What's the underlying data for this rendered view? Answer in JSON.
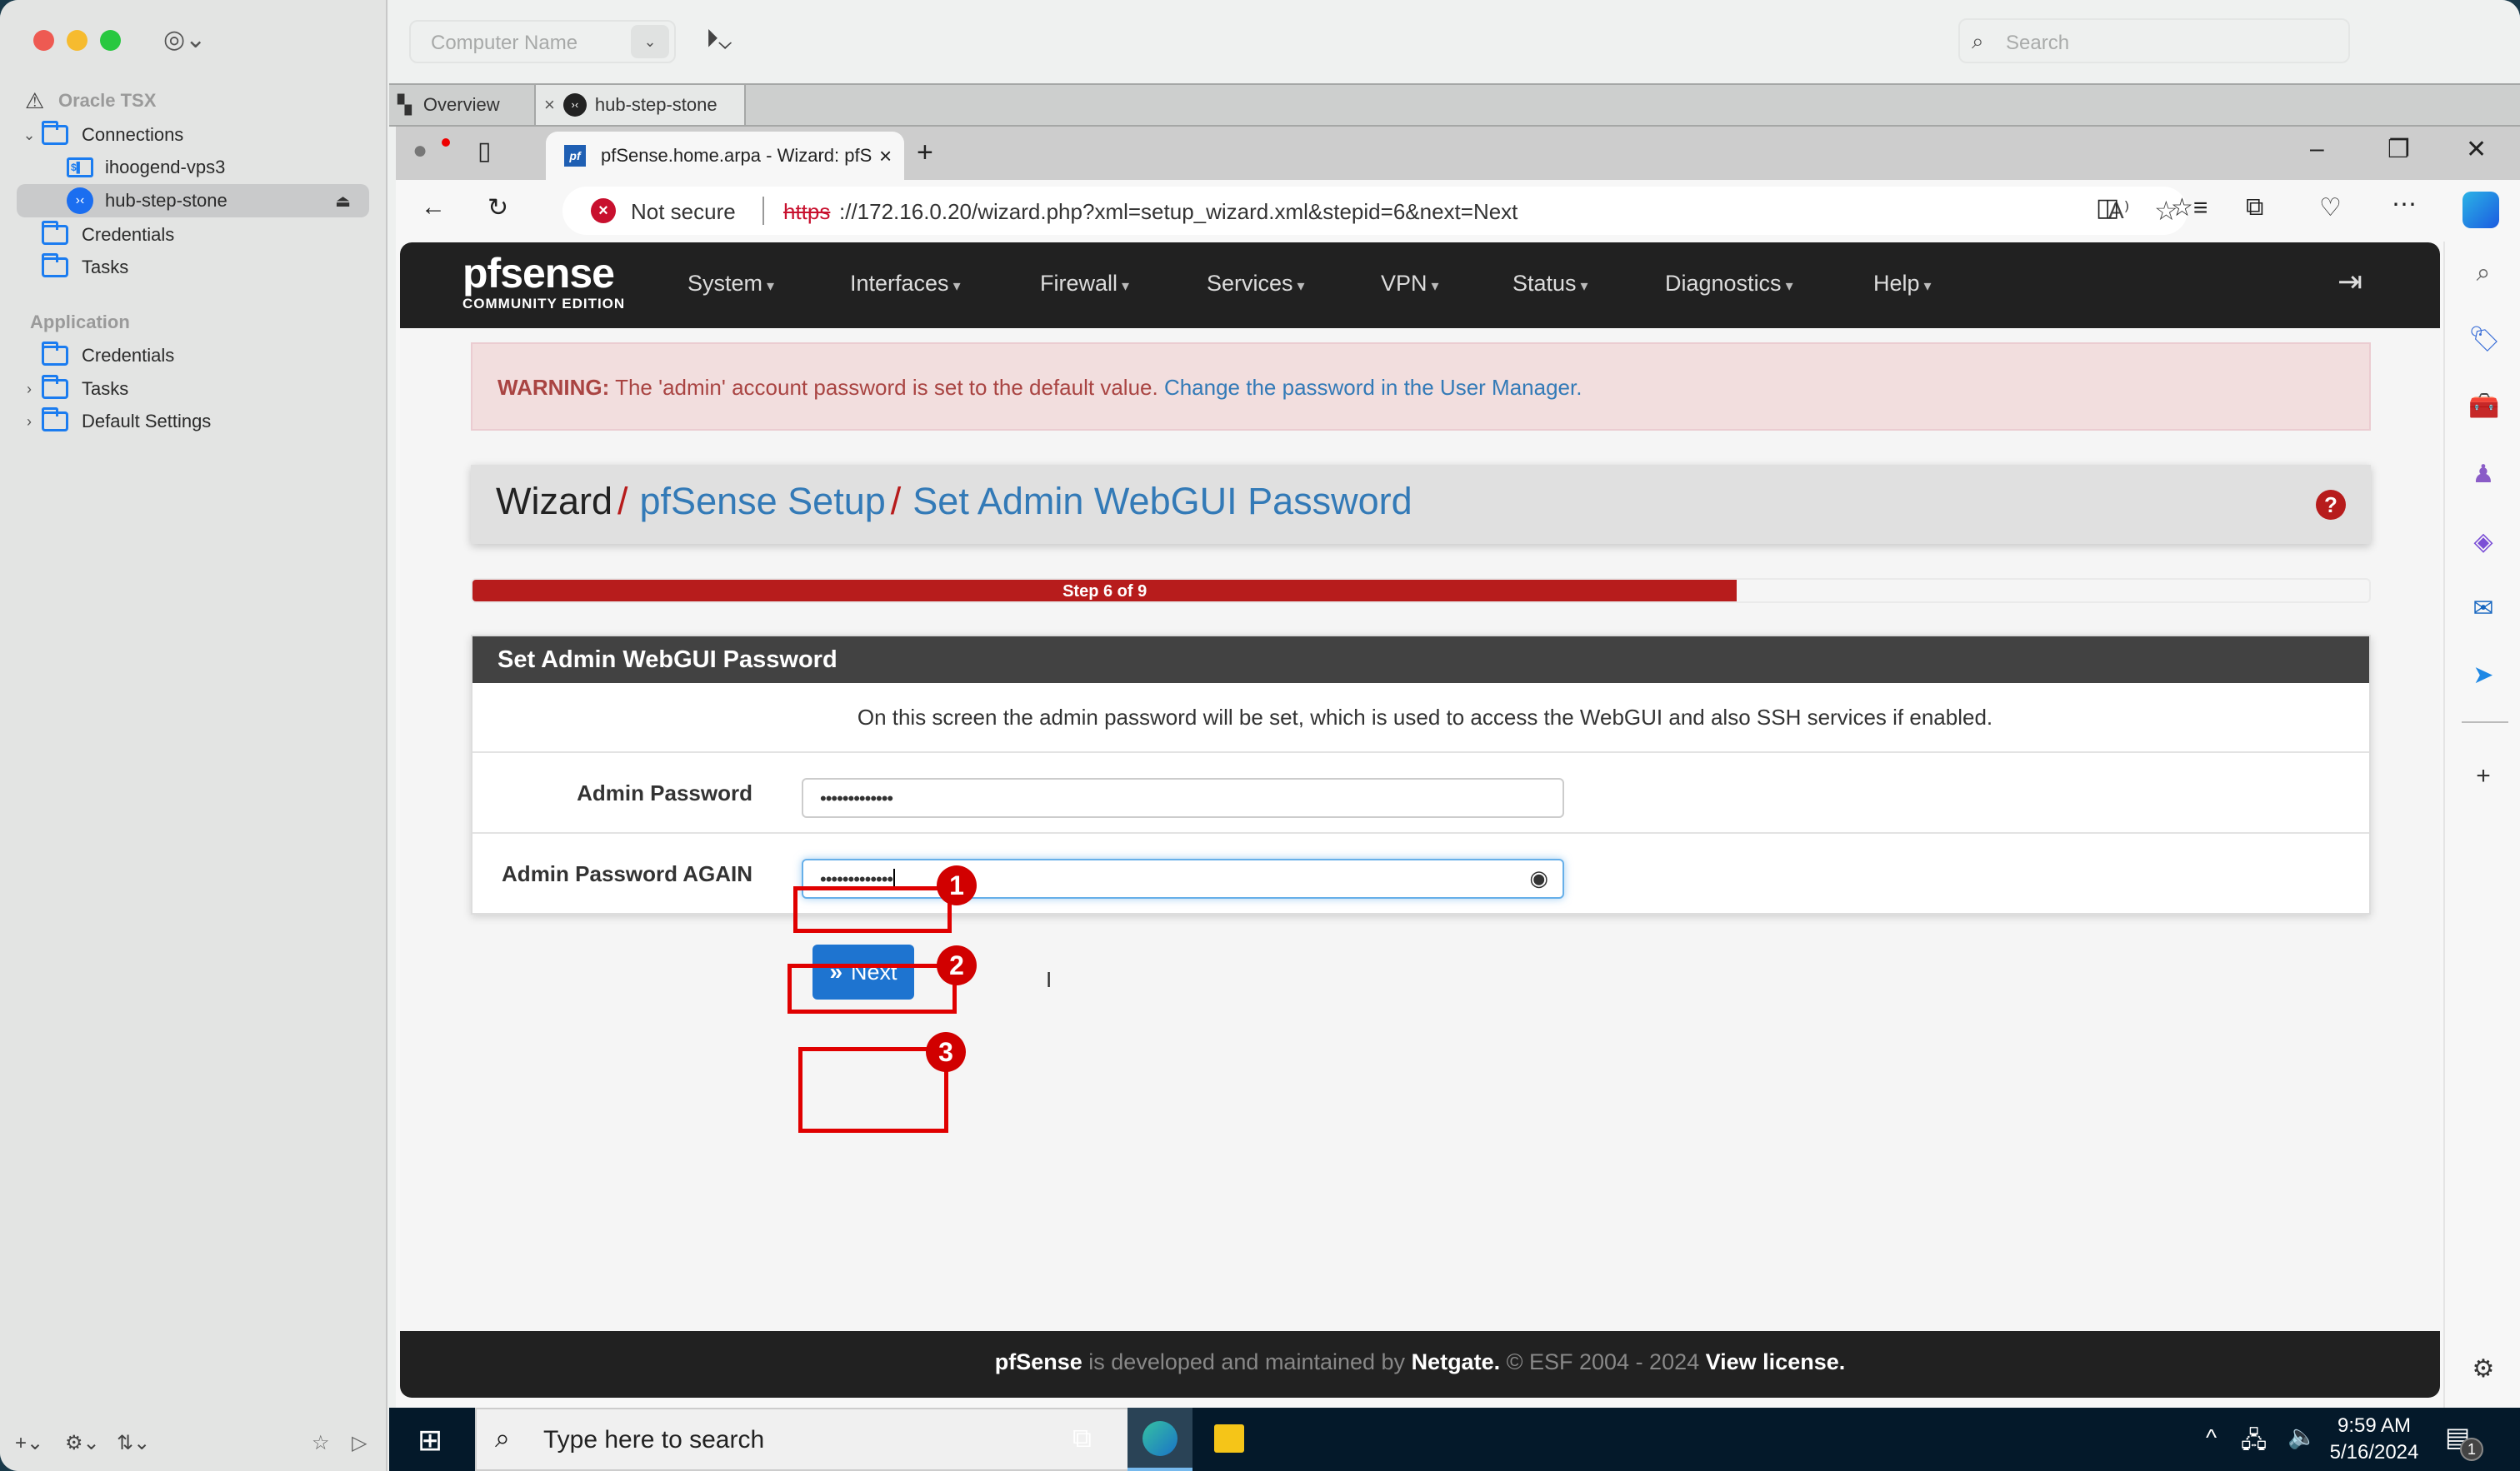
{
  "app_sidebar": {
    "group_title": "Oracle TSX",
    "items": [
      {
        "label": "Connections",
        "type": "folder",
        "expanded": true
      },
      {
        "label": "ihoogend-vps3",
        "type": "ssh"
      },
      {
        "label": "hub-step-stone",
        "type": "rdp",
        "selected": true
      },
      {
        "label": "Credentials",
        "type": "folder"
      },
      {
        "label": "Tasks",
        "type": "folder"
      }
    ],
    "application_section": "Application",
    "app_items": [
      {
        "label": "Credentials",
        "type": "folder"
      },
      {
        "label": "Tasks",
        "type": "folder",
        "collapsed": true
      },
      {
        "label": "Default Settings",
        "type": "folder",
        "collapsed": true
      }
    ]
  },
  "top_toolbar": {
    "computer_name_placeholder": "Computer Name",
    "search_placeholder": "Search"
  },
  "app_tabs": [
    {
      "label": "Overview"
    },
    {
      "label": "hub-step-stone",
      "active": true
    }
  ],
  "browser": {
    "tab_title": "pfSense.home.arpa - Wizard: pfS",
    "security_label": "Not secure",
    "url_scheme": "https",
    "url_rest": "://172.16.0.20/wizard.php?xml=setup_wizard.xml&stepid=6&next=Next"
  },
  "pfsense": {
    "logo_main": "pfsense",
    "logo_sub": "COMMUNITY EDITION",
    "menu": [
      "System",
      "Interfaces",
      "Firewall",
      "Services",
      "VPN",
      "Status",
      "Diagnostics",
      "Help"
    ],
    "warning_label": "WARNING:",
    "warning_text": " The 'admin' account password is set to the default value. ",
    "warning_link": "Change the password in the User Manager.",
    "breadcrumb": {
      "root": "Wizard",
      "parent": "pfSense Setup",
      "current": "Set Admin WebGUI Password"
    },
    "progress": {
      "label": "Step 6 of 9",
      "current": 6,
      "total": 9
    },
    "panel_title": "Set Admin WebGUI Password",
    "panel_description": "On this screen the admin password will be set, which is used to access the WebGUI and also SSH services if enabled.",
    "fields": [
      {
        "label": "Admin Password",
        "value": "•••••••••••••"
      },
      {
        "label": "Admin Password AGAIN",
        "value": "•••••••••••••"
      }
    ],
    "next_button": "Next",
    "footer": {
      "brand": "pfSense",
      "text1": " is developed and maintained by ",
      "company": "Netgate.",
      "text2": " © ESF 2004 - 2024 ",
      "license": "View license."
    }
  },
  "annotations": [
    "1",
    "2",
    "3"
  ],
  "taskbar": {
    "search_placeholder": "Type here to search",
    "time": "9:59 AM",
    "date": "5/16/2024",
    "notification_count": "1"
  }
}
